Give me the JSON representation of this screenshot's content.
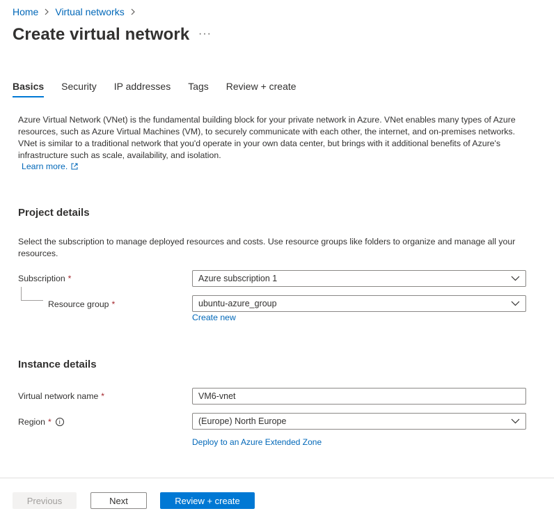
{
  "breadcrumb": {
    "home": "Home",
    "virtual_networks": "Virtual networks"
  },
  "page": {
    "title": "Create virtual network",
    "more": "···"
  },
  "tabs": [
    {
      "label": "Basics",
      "active": true
    },
    {
      "label": "Security",
      "active": false
    },
    {
      "label": "IP addresses",
      "active": false
    },
    {
      "label": "Tags",
      "active": false
    },
    {
      "label": "Review + create",
      "active": false
    }
  ],
  "intro": {
    "text": "Azure Virtual Network (VNet) is the fundamental building block for your private network in Azure. VNet enables many types of Azure resources, such as Azure Virtual Machines (VM), to securely communicate with each other, the internet, and on-premises networks. VNet is similar to a traditional network that you'd operate in your own data center, but brings with it additional benefits of Azure's infrastructure such as scale, availability, and isolation.",
    "learn_more": "Learn more."
  },
  "project_details": {
    "title": "Project details",
    "description": "Select the subscription to manage deployed resources and costs. Use resource groups like folders to organize and manage all your resources.",
    "subscription_label": "Subscription",
    "subscription_value": "Azure subscription 1",
    "resource_group_label": "Resource group",
    "resource_group_value": "ubuntu-azure_group",
    "create_new": "Create new",
    "required_mark": "*"
  },
  "instance_details": {
    "title": "Instance details",
    "vnet_name_label": "Virtual network name",
    "vnet_name_value": "VM6-vnet",
    "region_label": "Region",
    "region_value": "(Europe) North Europe",
    "info_glyph": "i",
    "extended_zone_link": "Deploy to an Azure Extended Zone"
  },
  "footer": {
    "previous": "Previous",
    "next": "Next",
    "review_create": "Review + create"
  },
  "colors": {
    "accent": "#0078d4",
    "link": "#0067b8",
    "required": "#a4262c"
  }
}
